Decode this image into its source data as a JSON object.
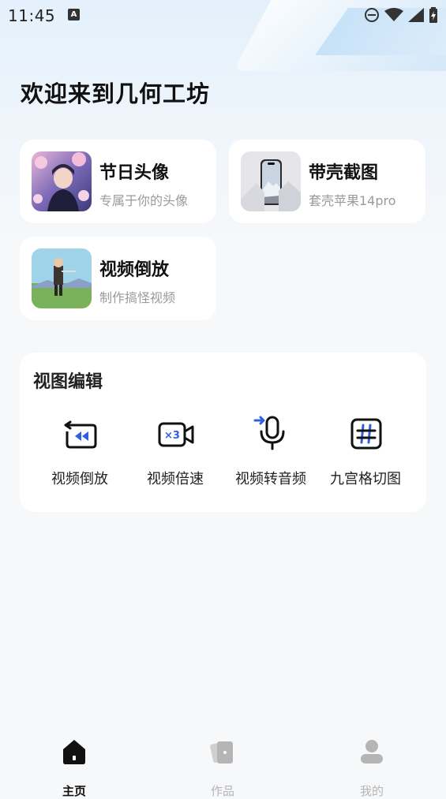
{
  "status_bar": {
    "time": "11:45",
    "notification_letter": "A"
  },
  "header": {
    "welcome": "欢迎来到几何工坊"
  },
  "feature_cards": [
    {
      "title": "节日头像",
      "subtitle": "专属于你的头像"
    },
    {
      "title": "带壳截图",
      "subtitle": "套壳苹果14pro"
    },
    {
      "title": "视频倒放",
      "subtitle": "制作搞怪视频"
    }
  ],
  "edit_section": {
    "title": "视图编辑",
    "tools": [
      {
        "label": "视频倒放",
        "icon": "rewind-icon",
        "badge": ""
      },
      {
        "label": "视频倍速",
        "icon": "speed-camera-icon",
        "badge": "×3"
      },
      {
        "label": "视频转音频",
        "icon": "microphone-icon",
        "badge": ""
      },
      {
        "label": "九宫格切图",
        "icon": "grid-icon",
        "badge": "#"
      }
    ]
  },
  "tabbar": {
    "tabs": [
      {
        "label": "主页",
        "icon": "home-icon",
        "active": true
      },
      {
        "label": "作品",
        "icon": "works-icon",
        "active": false
      },
      {
        "label": "我的",
        "icon": "profile-icon",
        "active": false
      }
    ]
  },
  "colors": {
    "accent_blue": "#2f5fe0",
    "icon_dark": "#111111",
    "inactive": "#b5b5b5",
    "subtitle": "#9a9a9a"
  }
}
